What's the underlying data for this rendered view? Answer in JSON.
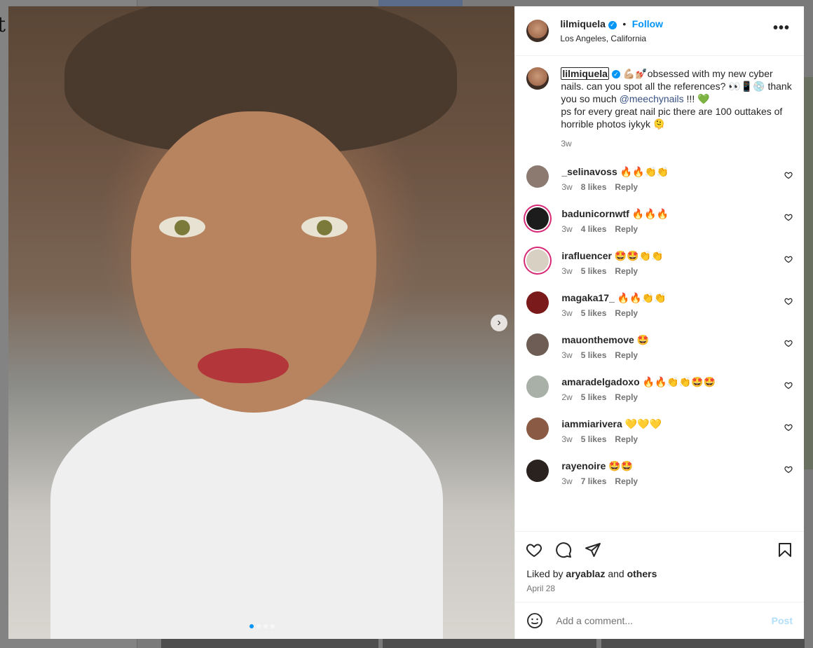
{
  "background": {
    "logo_fragment": "t"
  },
  "post": {
    "username": "lilmiquela",
    "follow_label": "Follow",
    "location": "Los Angeles, California",
    "more_label": "•••",
    "caption": {
      "username": "lilmiquela",
      "text_before_mention": "💪🏼💅🏼obsessed with my new cyber nails. can you spot all the references? 👀📱💿 thank you so much ",
      "mention": "@meechynails",
      "text_after_mention": " !!! 💚",
      "text_line2": "ps for every great nail pic there are 100 outtakes of horrible photos iykyk 🫠",
      "time": "3w"
    },
    "carousel": {
      "slide_count": 4,
      "active_index": 0,
      "next_icon": "chevron-right-icon"
    },
    "comments": [
      {
        "username": "_selinavoss",
        "text": "🔥🔥👏👏",
        "time": "3w",
        "likes": "8 likes",
        "reply": "Reply",
        "avatar_color": "#8c7a70",
        "ring": false
      },
      {
        "username": "badunicornwtf",
        "text": "🔥🔥🔥",
        "time": "3w",
        "likes": "4 likes",
        "reply": "Reply",
        "avatar_color": "#1c1c1c",
        "ring": true
      },
      {
        "username": "irafluencer",
        "text": "🤩🤩👏👏",
        "time": "3w",
        "likes": "5 likes",
        "reply": "Reply",
        "avatar_color": "#d8d0c2",
        "ring": true
      },
      {
        "username": "magaka17_",
        "text": "🔥🔥👏👏",
        "time": "3w",
        "likes": "5 likes",
        "reply": "Reply",
        "avatar_color": "#7a1a1a",
        "ring": false
      },
      {
        "username": "mauonthemove",
        "text": "🤩",
        "time": "3w",
        "likes": "5 likes",
        "reply": "Reply",
        "avatar_color": "#6d5d55",
        "ring": false
      },
      {
        "username": "amaradelgadoxo",
        "text": "🔥🔥👏👏🤩🤩",
        "time": "2w",
        "likes": "5 likes",
        "reply": "Reply",
        "avatar_color": "#a8b0a8",
        "ring": false
      },
      {
        "username": "iammiarivera",
        "text": "💛💛💛",
        "time": "3w",
        "likes": "5 likes",
        "reply": "Reply",
        "avatar_color": "#8a5a44",
        "ring": false
      },
      {
        "username": "rayenoire",
        "text": "🤩🤩",
        "time": "3w",
        "likes": "7 likes",
        "reply": "Reply",
        "avatar_color": "#2a221e",
        "ring": false
      }
    ],
    "liked_by_prefix": "Liked by ",
    "liked_by_user": "aryablaz",
    "liked_by_and": " and ",
    "liked_by_others": "others",
    "date": "April 28",
    "add_comment_placeholder": "Add a comment...",
    "post_label": "Post"
  },
  "colors": {
    "accent": "#0095f6",
    "post_disabled": "#b2dffc",
    "mention": "#385185"
  }
}
